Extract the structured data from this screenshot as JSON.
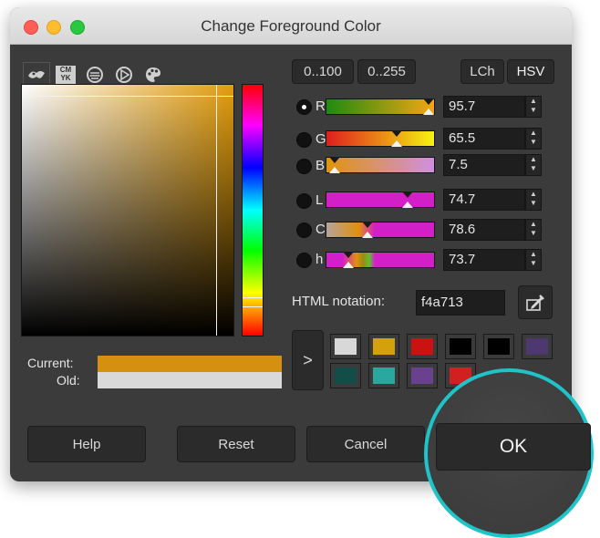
{
  "window": {
    "title": "Change Foreground Color"
  },
  "selector_tabs": [
    {
      "name": "gimp-selector-icon"
    },
    {
      "name": "cmyk-selector-icon",
      "label": "CM\nYK"
    },
    {
      "name": "watercolor-selector-icon"
    },
    {
      "name": "wheel-selector-icon"
    },
    {
      "name": "palette-selector-icon"
    }
  ],
  "range_buttons": {
    "range_100": "0..100",
    "range_255": "0..255"
  },
  "model_buttons": {
    "lch": "LCh",
    "hsv": "HSV"
  },
  "channels": [
    {
      "label": "R",
      "value": "95.7",
      "selected": true
    },
    {
      "label": "G",
      "value": "65.5",
      "selected": false
    },
    {
      "label": "B",
      "value": "7.5",
      "selected": false
    },
    {
      "label": "L",
      "value": "74.7",
      "selected": false
    },
    {
      "label": "C",
      "value": "78.6",
      "selected": false
    },
    {
      "label": "h",
      "value": "73.7",
      "selected": false
    }
  ],
  "html_notation": {
    "label": "HTML notation:",
    "value": "f4a713"
  },
  "color_preview": {
    "current_label": "Current:",
    "old_label": "Old:",
    "current_color": "#d4900e",
    "old_color": "#d9d9d9"
  },
  "history": {
    "row1": [
      "#d8d8d8",
      "#d4a00c",
      "#cc1111",
      "#000000",
      "#000000",
      "#4e3870"
    ],
    "row2": [
      "#124d48",
      "#2aa79f",
      "#69418f",
      "#d21f1f",
      "#f0f0f0",
      "#1c1c1c"
    ]
  },
  "buttons": {
    "help": "Help",
    "reset": "Reset",
    "cancel": "Cancel",
    "ok": "OK"
  },
  "accent": {
    "highlight_ring": "#1fc3c8"
  }
}
